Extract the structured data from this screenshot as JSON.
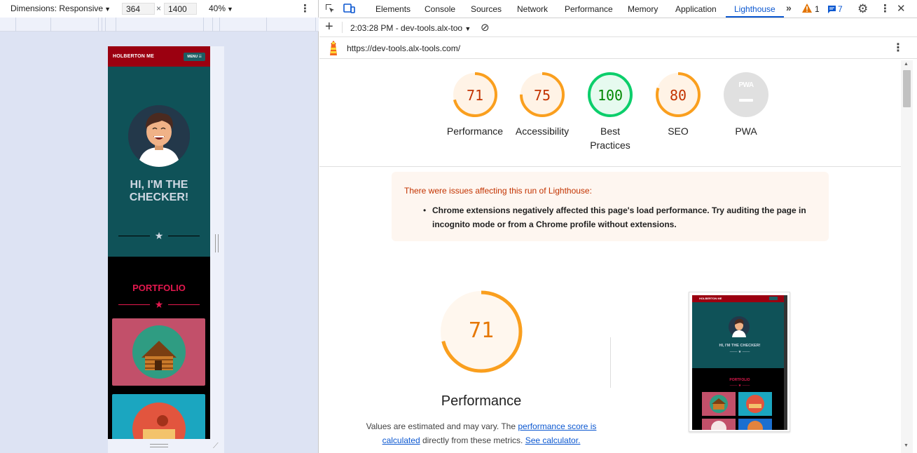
{
  "emulation": {
    "dimensions_label": "Dimensions: Responsive",
    "width_value": "364",
    "height_value": "1400",
    "times": "×",
    "zoom": "40%"
  },
  "site": {
    "brand": "HOLBERTON ME",
    "menu": "MENU ☰",
    "hero_title": "HI, I'M THE CHECKER!",
    "portfolio": "PORTFOLIO"
  },
  "devtools": {
    "tabs": [
      "Elements",
      "Console",
      "Sources",
      "Network",
      "Performance",
      "Memory",
      "Application",
      "Lighthouse"
    ],
    "active_tab": "Lighthouse",
    "warnings_count": "1",
    "messages_count": "7"
  },
  "lighthouse": {
    "report_time": "2:03:28 PM - dev-tools.alx-too",
    "url": "https://dev-tools.alx-tools.com/",
    "categories": [
      {
        "label": "Performance",
        "score": 71,
        "color": "#fa9f1e",
        "bg": "#fff3e6",
        "text_color": "#c33300"
      },
      {
        "label": "Accessibility",
        "score": 75,
        "color": "#fa9f1e",
        "bg": "#fff3e6",
        "text_color": "#c33300"
      },
      {
        "label": "Best Practices",
        "score": 100,
        "color": "#0cce6b",
        "bg": "#e6faef",
        "text_color": "#008800"
      },
      {
        "label": "SEO",
        "score": 80,
        "color": "#fa9f1e",
        "bg": "#fff3e6",
        "text_color": "#c33300"
      },
      {
        "label": "PWA",
        "score": null,
        "color": "#d9d9d9",
        "bg": "#e0e0e0",
        "text_color": "#fff"
      }
    ],
    "pwa_badge": "PWA",
    "warning_head": "There were issues affecting this run of Lighthouse:",
    "warning_item": "Chrome extensions negatively affected this page's load performance. Try auditing the page in incognito mode or from a Chrome profile without extensions.",
    "perf_score": "71",
    "perf_title": "Performance",
    "perf_note_1": "Values are estimated and may vary. The",
    "perf_link_1": "performance score is calculated",
    "perf_note_2": "directly from these metrics.",
    "perf_link_2": "See calculator."
  },
  "thumbnail": {
    "brand": "HOLBERTON ME",
    "hero_title": "HI, I'M THE CHECKER!",
    "portfolio": "PORTFOLIO"
  }
}
